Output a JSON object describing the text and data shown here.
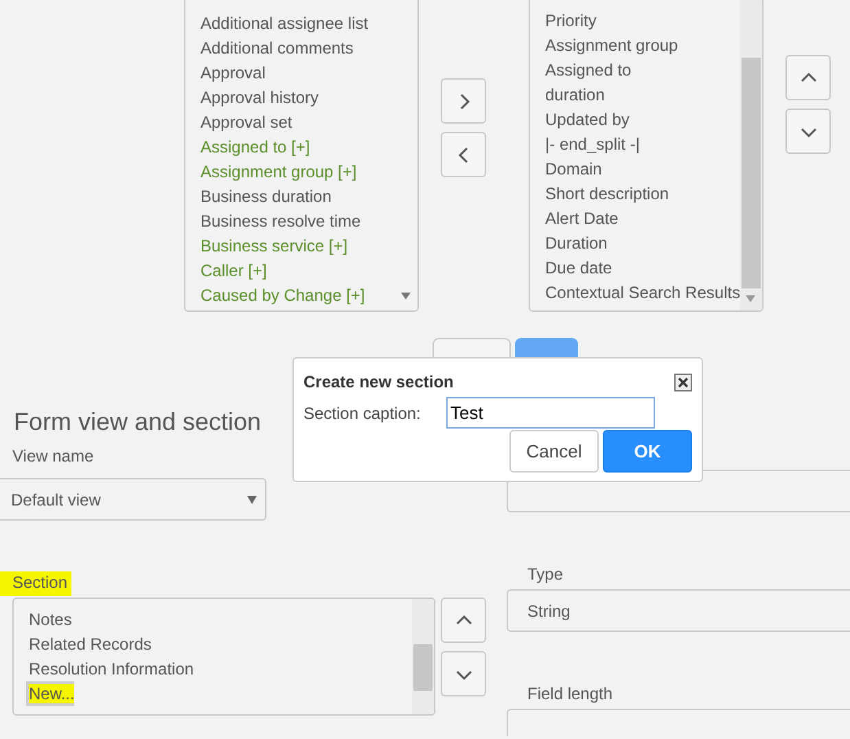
{
  "available_fields": {
    "items": [
      {
        "label": "Additional assignee list",
        "kind": "field"
      },
      {
        "label": "Additional comments",
        "kind": "field"
      },
      {
        "label": "Approval",
        "kind": "field"
      },
      {
        "label": "Approval history",
        "kind": "field"
      },
      {
        "label": "Approval set",
        "kind": "field"
      },
      {
        "label": "Assigned to [+]",
        "kind": "reference"
      },
      {
        "label": "Assignment group [+]",
        "kind": "reference"
      },
      {
        "label": "Business duration",
        "kind": "field"
      },
      {
        "label": "Business resolve time",
        "kind": "field"
      },
      {
        "label": "Business service [+]",
        "kind": "reference"
      },
      {
        "label": "Caller [+]",
        "kind": "reference"
      },
      {
        "label": "Caused by Change [+]",
        "kind": "reference"
      }
    ]
  },
  "selected_fields": {
    "items": [
      {
        "label": "Priority"
      },
      {
        "label": "Assignment group"
      },
      {
        "label": "Assigned to"
      },
      {
        "label": "duration"
      },
      {
        "label": "Updated by"
      },
      {
        "label": "|- end_split -|"
      },
      {
        "label": "Domain"
      },
      {
        "label": "Short description"
      },
      {
        "label": "Alert Date"
      },
      {
        "label": "Duration"
      },
      {
        "label": "Due date"
      },
      {
        "label": "Contextual Search Results"
      }
    ]
  },
  "dialog": {
    "title": "Create new section",
    "field_label": "Section caption:",
    "value": "Test",
    "buttons": [
      {
        "label": "Cancel",
        "kind": "secondary"
      },
      {
        "label": "OK",
        "kind": "primary"
      }
    ]
  },
  "form_view": {
    "heading": "Form view and section",
    "view_label": "View name",
    "view_value": "Default view",
    "section_label": "Section",
    "section_label_highlighted": true,
    "sections": [
      {
        "label": "Notes",
        "selected": false,
        "highlighted": false
      },
      {
        "label": "Related Records",
        "selected": false,
        "highlighted": false
      },
      {
        "label": "Resolution Information",
        "selected": false,
        "highlighted": false
      },
      {
        "label": "New...",
        "selected": true,
        "highlighted": true
      }
    ]
  },
  "properties": {
    "type_label": "Type",
    "type_value": "String",
    "length_label": "Field length"
  }
}
